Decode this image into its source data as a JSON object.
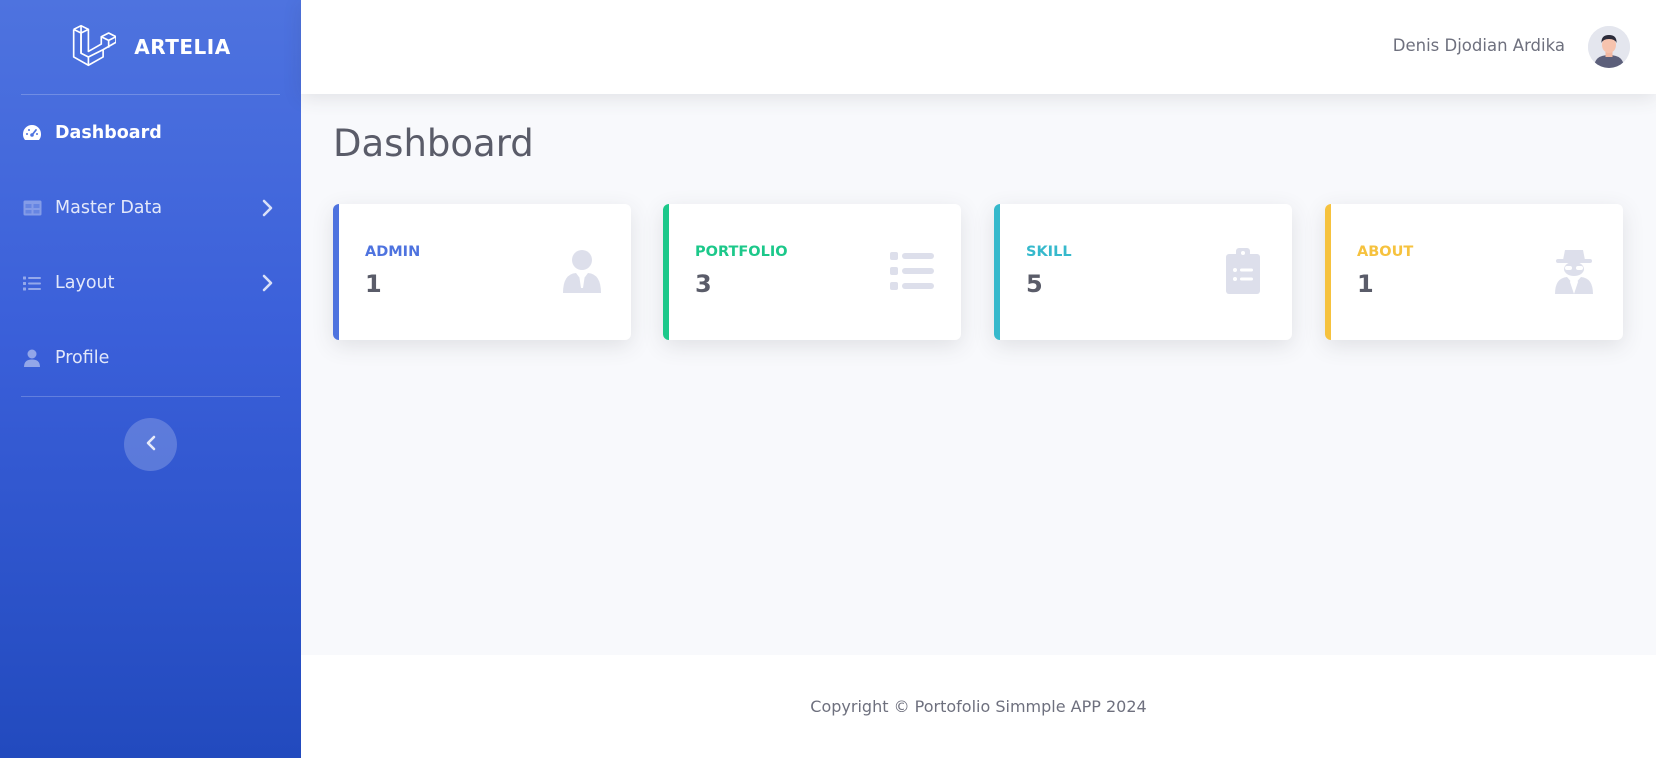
{
  "brand": {
    "name": "ARTELIA",
    "logo_icon": "laravel-logo-icon"
  },
  "sidebar": {
    "items": [
      {
        "label": "Dashboard",
        "icon": "tachometer-icon",
        "active": true,
        "has_submenu": false
      },
      {
        "label": "Master Data",
        "icon": "table-icon",
        "active": false,
        "has_submenu": true
      },
      {
        "label": "Layout",
        "icon": "list-icon",
        "active": false,
        "has_submenu": true
      },
      {
        "label": "Profile",
        "icon": "user-icon",
        "active": false,
        "has_submenu": false
      }
    ],
    "toggle_icon": "chevron-left-icon"
  },
  "topbar": {
    "user_name": "Denis Djodian Ardika",
    "avatar_icon": "avatar"
  },
  "main": {
    "title": "Dashboard",
    "cards": [
      {
        "label": "ADMIN",
        "value": "1",
        "color": "#4e73df",
        "icon": "user-tie-icon"
      },
      {
        "label": "PORTFOLIO",
        "value": "3",
        "color": "#1cc88a",
        "icon": "list-icon"
      },
      {
        "label": "SKILL",
        "value": "5",
        "color": "#36b9cc",
        "icon": "clipboard-list-icon"
      },
      {
        "label": "ABOUT",
        "value": "1",
        "color": "#f6c23e",
        "icon": "user-secret-icon"
      }
    ]
  },
  "footer": {
    "text": "Copyright © Portofolio Simmple APP 2024"
  },
  "colors": {
    "sidebar_top": "#4e73df",
    "sidebar_bottom": "#224abe",
    "background": "#f8f9fc",
    "card_icon": "#dddfeb"
  }
}
